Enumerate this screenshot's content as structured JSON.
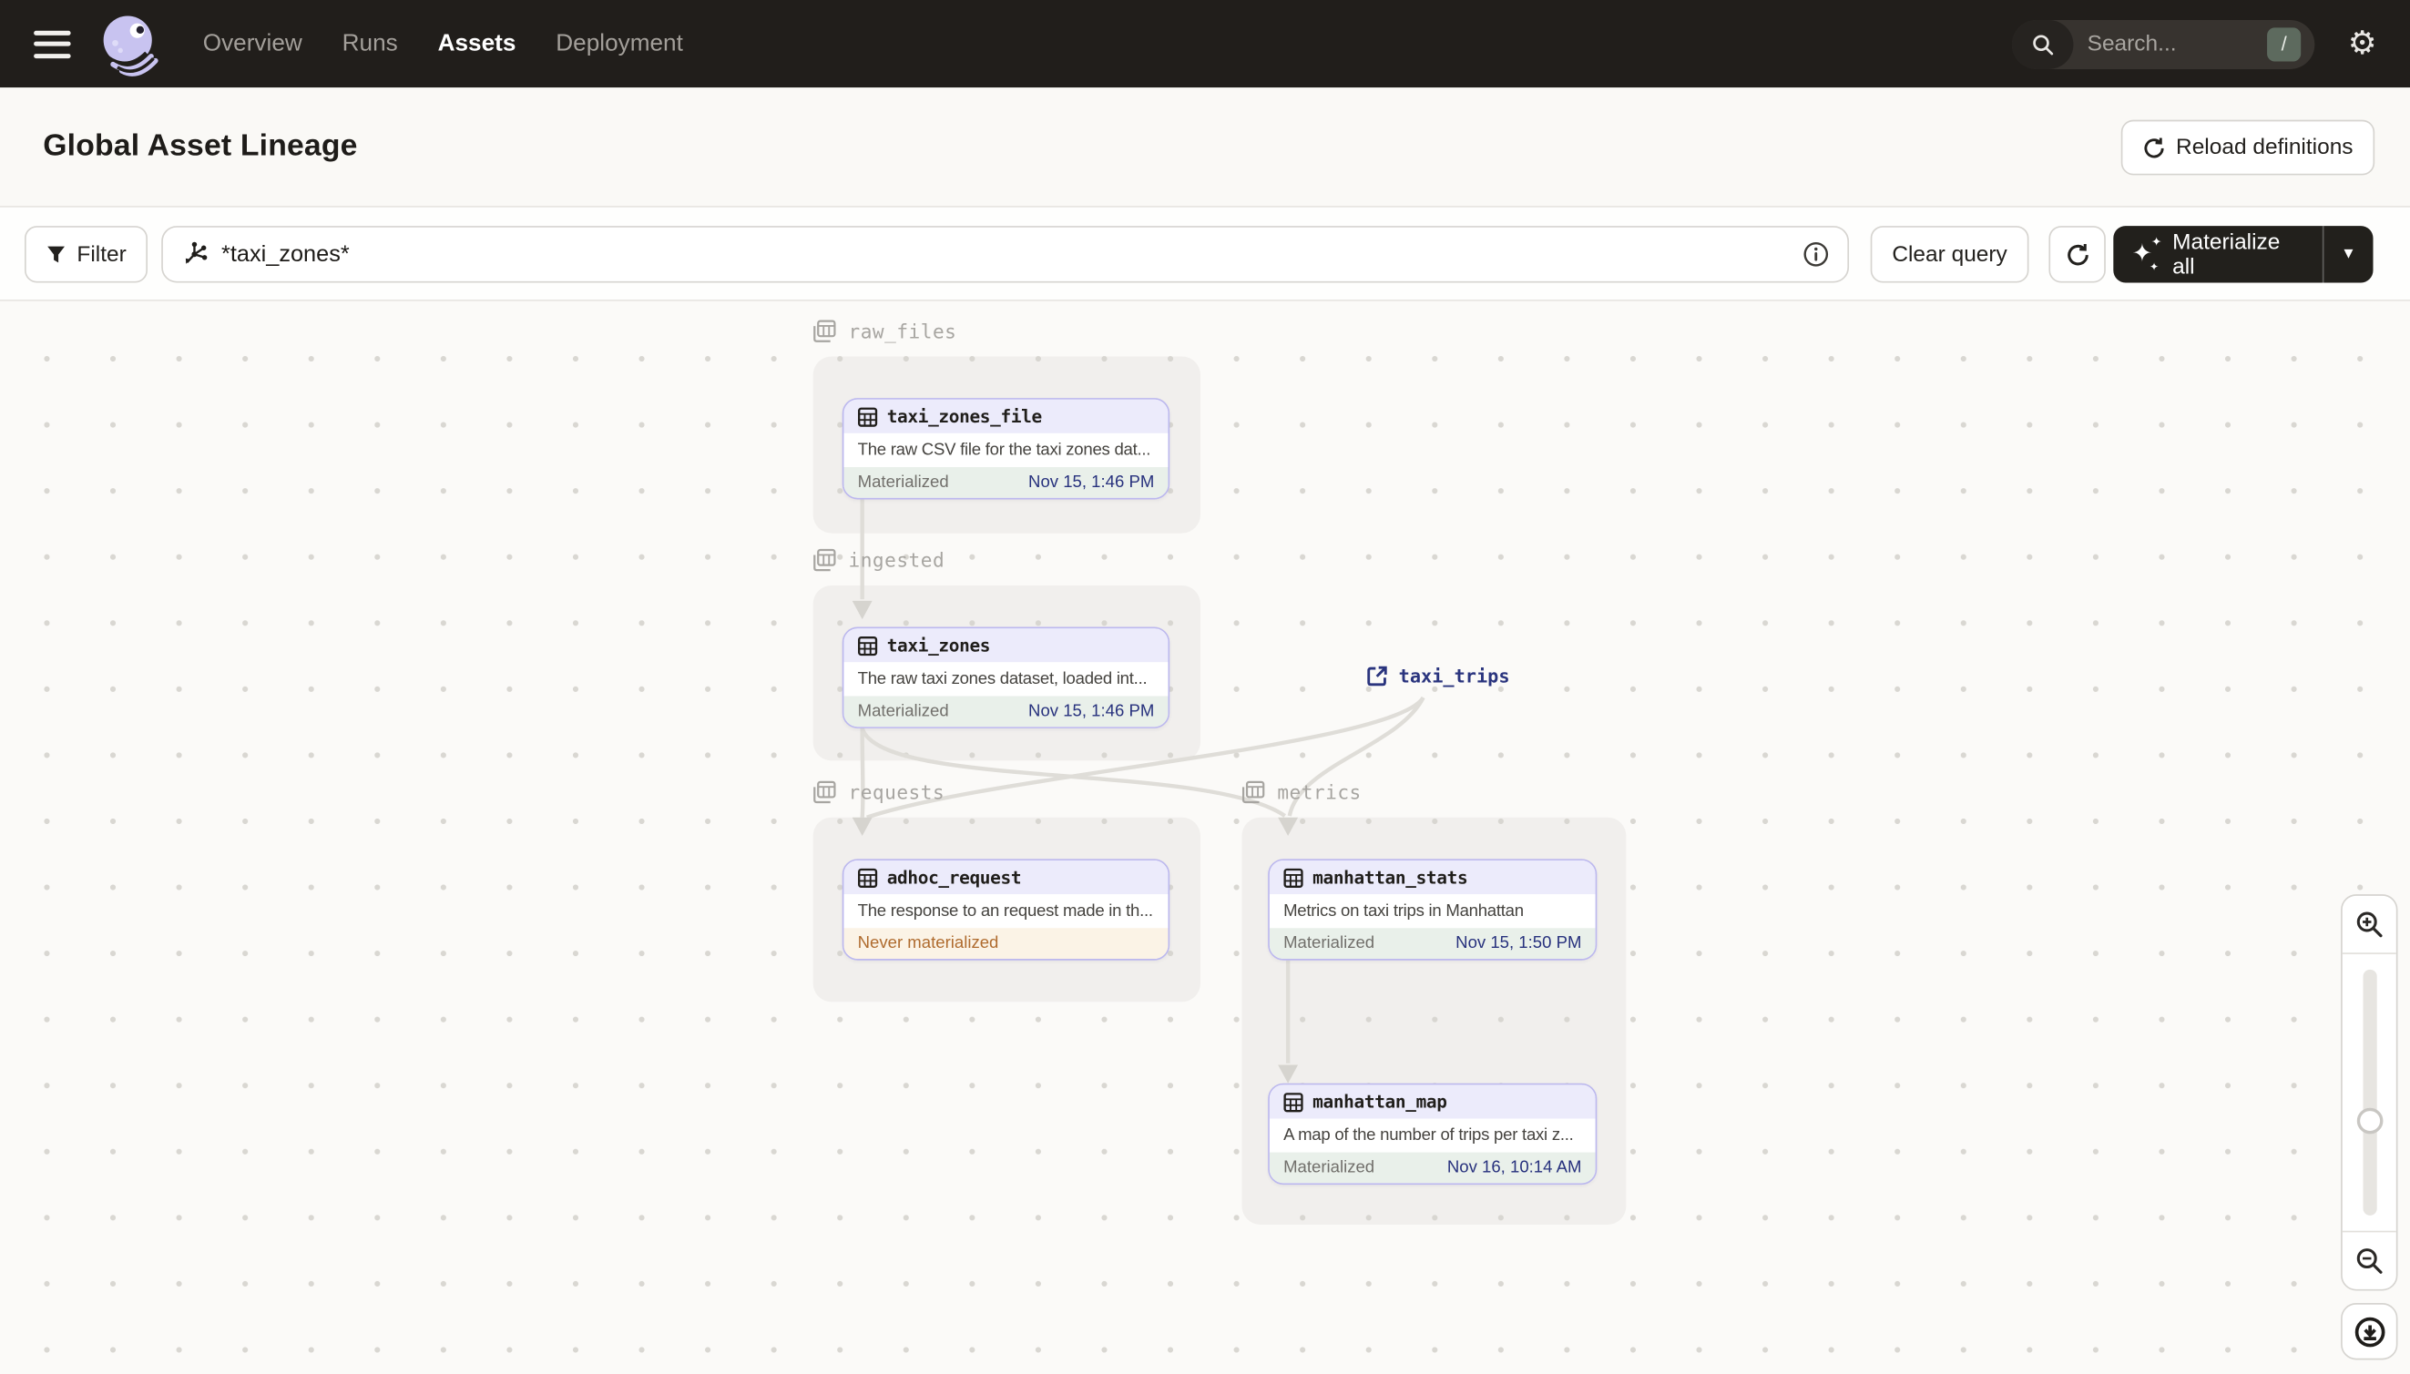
{
  "nav": {
    "items": [
      {
        "label": "Overview",
        "active": false
      },
      {
        "label": "Runs",
        "active": false
      },
      {
        "label": "Assets",
        "active": true
      },
      {
        "label": "Deployment",
        "active": false
      }
    ],
    "search": {
      "placeholder": "Search...",
      "shortcut": "/"
    }
  },
  "header": {
    "title": "Global Asset Lineage",
    "reload_label": "Reload definitions"
  },
  "toolbar": {
    "filter_label": "Filter",
    "query_value": "*taxi_zones*",
    "clear_query_label": "Clear query",
    "materialize_label": "Materialize all"
  },
  "graph": {
    "groups": [
      {
        "name": "raw_files"
      },
      {
        "name": "ingested"
      },
      {
        "name": "requests"
      },
      {
        "name": "metrics"
      }
    ],
    "nodes": [
      {
        "id": "taxi_zones_file",
        "group": "raw_files",
        "description": "The raw CSV file for the taxi zones dat...",
        "status": "Materialized",
        "status_time": "Nov 15, 1:46 PM"
      },
      {
        "id": "taxi_zones",
        "group": "ingested",
        "description": "The raw taxi zones dataset, loaded int...",
        "status": "Materialized",
        "status_time": "Nov 15, 1:46 PM"
      },
      {
        "id": "adhoc_request",
        "group": "requests",
        "description": "The response to an request made in th...",
        "status": "Never materialized",
        "status_time": ""
      },
      {
        "id": "manhattan_stats",
        "group": "metrics",
        "description": "Metrics on taxi trips in Manhattan",
        "status": "Materialized",
        "status_time": "Nov 15, 1:50 PM"
      },
      {
        "id": "manhattan_map",
        "group": "metrics",
        "description": "A map of the number of trips per taxi z...",
        "status": "Materialized",
        "status_time": "Nov 16, 10:14 AM"
      }
    ],
    "external_assets": [
      {
        "id": "taxi_trips"
      }
    ],
    "edges": [
      [
        "taxi_zones_file",
        "taxi_zones"
      ],
      [
        "taxi_zones",
        "adhoc_request"
      ],
      [
        "taxi_zones",
        "manhattan_stats"
      ],
      [
        "taxi_trips",
        "adhoc_request"
      ],
      [
        "taxi_trips",
        "manhattan_stats"
      ],
      [
        "manhattan_stats",
        "manhattan_map"
      ]
    ]
  },
  "icons": {
    "hamburger": "menu-icon",
    "logo": "dagster-logo",
    "search": "magnifier",
    "settings": "gear",
    "reload": "refresh-arrow",
    "filter": "funnel",
    "query": "asset-graph",
    "info": "circled-i",
    "materialize": "sparkles",
    "caret": "chevron-down",
    "group": "layered-table",
    "asset": "table-grid",
    "external": "external-link",
    "zoom_in": "magnifier-plus",
    "zoom_out": "magnifier-minus",
    "download": "circled-download-arrow"
  },
  "colors": {
    "topbar_bg": "#211E1B",
    "accent_lavender": "#C8C3F0",
    "node_border": "#BCB8EE",
    "node_header_bg": "#ECEBFB",
    "materialized_bg": "#E9F0EA",
    "materialized_time": "#27317D",
    "never_materialized_bg": "#FBF3E6",
    "never_materialized_text": "#AF6B2E",
    "edge": "#DFDDD8"
  }
}
